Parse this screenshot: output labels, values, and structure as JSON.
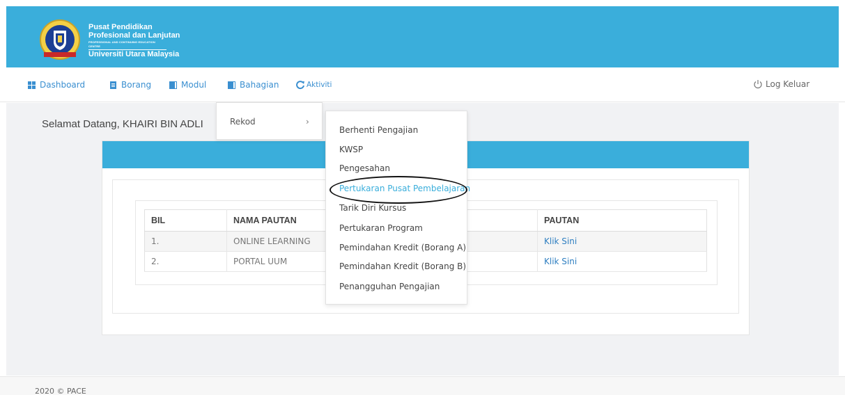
{
  "header": {
    "logo_line1": "Pusat Pendidikan",
    "logo_line2": "Profesional dan Lanjutan",
    "logo_line3": "PROFESSIONAL AND CONTINUING EDUCATION CENTRE",
    "logo_line4": "Universiti Utara Malaysia",
    "accent_color": "#3aaedb"
  },
  "nav": {
    "items": [
      {
        "label": "Dashboard",
        "icon": "grid-icon"
      },
      {
        "label": "Borang",
        "icon": "document-icon"
      },
      {
        "label": "Modul",
        "icon": "book-icon"
      },
      {
        "label": "Bahagian",
        "icon": "book-icon"
      },
      {
        "label": "Aktiviti",
        "icon": "refresh-icon"
      }
    ],
    "logout": "Log Keluar"
  },
  "welcome": "Selamat Datang, KHAIRI BIN ADLI",
  "table": {
    "headers": [
      "BIL",
      "NAMA PAUTAN",
      "PAUTAN"
    ],
    "rows": [
      {
        "bil": "1.",
        "nama": "ONLINE LEARNING",
        "pautan": "Klik Sini"
      },
      {
        "bil": "2.",
        "nama": "PORTAL UUM",
        "pautan": "Klik Sini"
      }
    ]
  },
  "menu": {
    "level1": {
      "label": "Rekod",
      "chevron": "›"
    },
    "level2": [
      "Berhenti Pengajian",
      "KWSP",
      "Pengesahan",
      "Pertukaran Pusat Pembelajaran",
      "Tarik Diri Kursus",
      "Pertukaran Program",
      "Pemindahan Kredit (Borang A)",
      "Pemindahan Kredit (Borang B)",
      "Penangguhan Pengajian"
    ],
    "active_color": "#3aaedb"
  },
  "footer": "2020 © PACE"
}
